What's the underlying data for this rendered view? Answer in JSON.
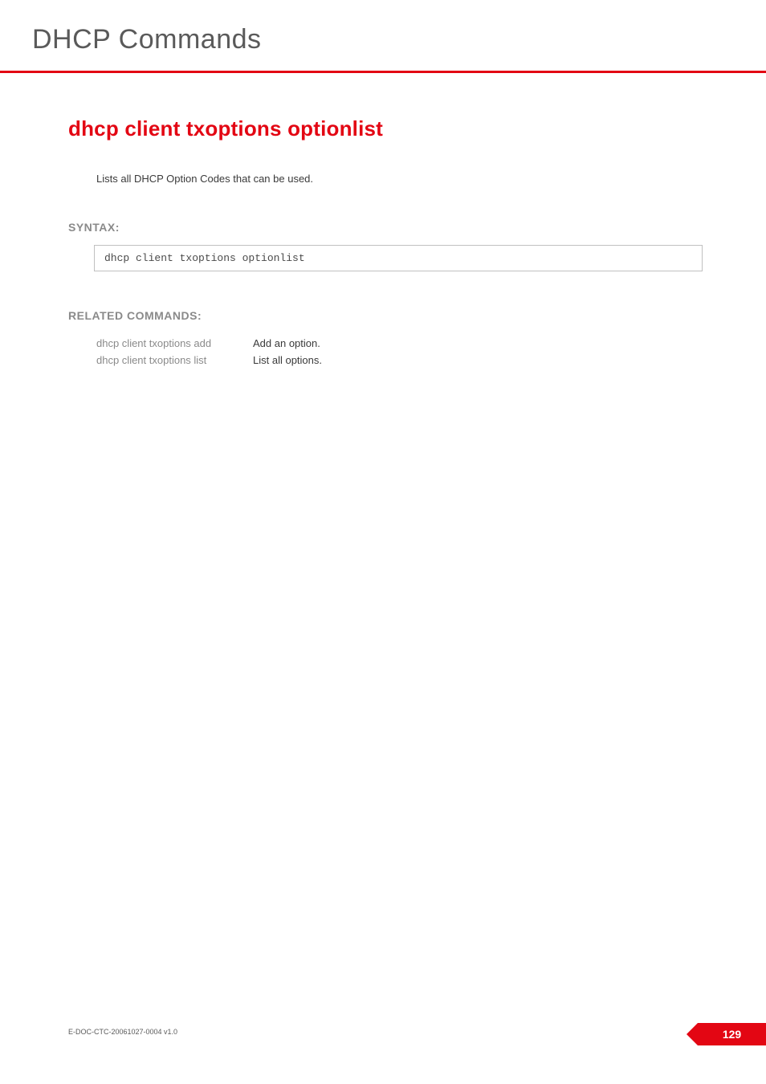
{
  "header": {
    "title": "DHCP Commands"
  },
  "section": {
    "heading": "dhcp client txoptions optionlist",
    "description": "Lists all DHCP Option Codes that can be used."
  },
  "syntax": {
    "label": "SYNTAX:",
    "code": "dhcp client txoptions optionlist"
  },
  "related": {
    "label": "RELATED COMMANDS:",
    "rows": [
      {
        "cmd": "dhcp client txoptions add",
        "desc": "Add an option."
      },
      {
        "cmd": "dhcp client txoptions list",
        "desc": "List all options."
      }
    ]
  },
  "footer": {
    "doc_id": "E-DOC-CTC-20061027-0004 v1.0",
    "page_number": "129"
  }
}
